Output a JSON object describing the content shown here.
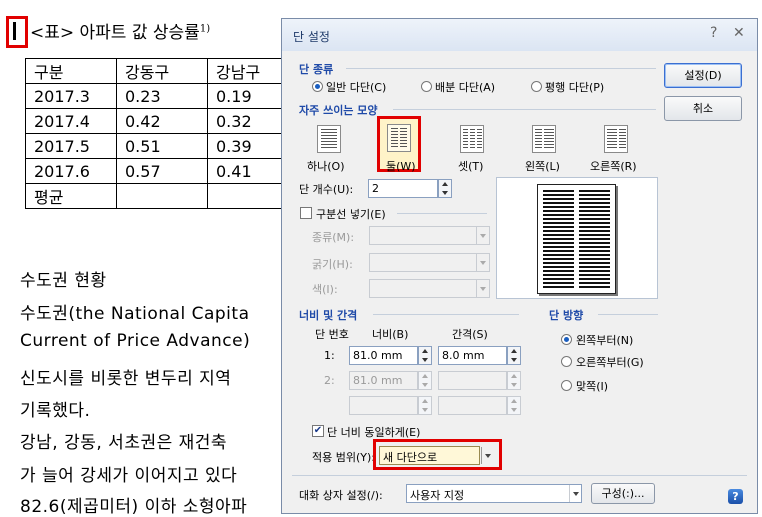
{
  "document": {
    "title": "<표> 아파트 값 상승률",
    "title_sup": "1)",
    "table": {
      "headers": [
        "구분",
        "강동구",
        "강남구"
      ],
      "rows": [
        [
          "2017.3",
          "0.23",
          "0.19"
        ],
        [
          "2017.4",
          "0.42",
          "0.32"
        ],
        [
          "2017.5",
          "0.51",
          "0.39"
        ],
        [
          "2017.6",
          "0.57",
          "0.41"
        ],
        [
          "평균",
          "",
          ""
        ]
      ]
    },
    "lines": [
      "수도권 현황",
      "수도권(the National Capita",
      "Current of Price Advance)",
      "신도시를 비롯한 변두리 지역",
      "기록했다.",
      "강남, 강동, 서초권은 재건축",
      "가 늘어 강세가 이어지고 있다",
      "82.6(제곱미터) 이하 소형아파"
    ]
  },
  "dialog": {
    "title": "단 설정",
    "help_glyph": "?",
    "close_glyph": "✕",
    "type_section": "단 종류",
    "type_options": [
      "일반 다단(C)",
      "배분 다단(A)",
      "평행 다단(P)"
    ],
    "presets_section": "자주 쓰이는 모양",
    "presets": [
      "하나(O)",
      "둘(W)",
      "셋(T)",
      "왼쪽(L)",
      "오른쪽(R)"
    ],
    "col_count_label": "단 개수(U):",
    "col_count_value": "2",
    "separator_check": "구분선 넣기(E)",
    "sep_type_label": "종류(M):",
    "sep_width_label": "굵기(H):",
    "sep_color_label": "색(I):",
    "width_section": "너비 및 간격",
    "col_no_header": "단 번호",
    "width_header": "너비(B)",
    "gap_header": "간격(S)",
    "row1_no": "1:",
    "row1_width": "81.0 mm",
    "row1_gap": "8.0 mm",
    "row2_no": "2:",
    "row2_width": "81.0 mm",
    "direction_section": "단 방향",
    "direction_options": [
      "왼쪽부터(N)",
      "오른쪽부터(G)",
      "맞쪽(I)"
    ],
    "equal_width_check": "단 너비 동일하게(E)",
    "apply_label": "적용 범위(Y):",
    "apply_value": "새 다단으로",
    "dialog_setting_label": "대화 상자 설정(/):",
    "dialog_setting_value": "사용자 지정",
    "config_button": "구성(:)...",
    "ok_button": "설정(D)",
    "cancel_button": "취소",
    "help_icon_glyph": "?"
  },
  "colors": {
    "highlight_box": "#e10000",
    "section_header": "#1f4aa8"
  }
}
